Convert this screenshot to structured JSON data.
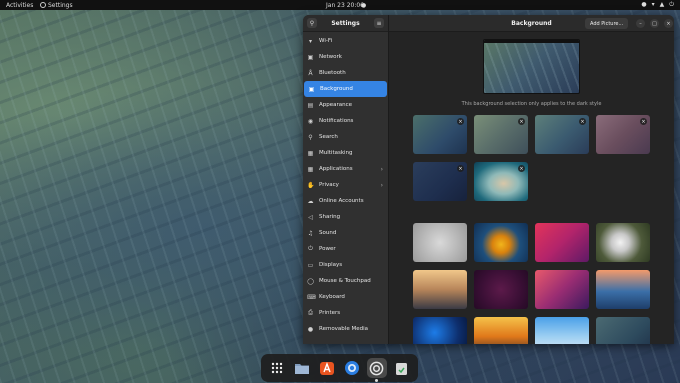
{
  "topbar": {
    "activities": "Activities",
    "app_name": "Settings",
    "clock": "Jan 23  20:06"
  },
  "window": {
    "sidebar_title": "Settings",
    "page_title": "Background",
    "add_picture": "Add Picture...",
    "caption": "This background selection only applies to the dark style"
  },
  "sidebar": {
    "items": [
      {
        "label": "Wi-Fi",
        "icon": "wifi-icon"
      },
      {
        "label": "Network",
        "icon": "network-icon"
      },
      {
        "label": "Bluetooth",
        "icon": "bluetooth-icon"
      },
      {
        "label": "Background",
        "icon": "background-icon"
      },
      {
        "label": "Appearance",
        "icon": "appearance-icon"
      },
      {
        "label": "Notifications",
        "icon": "bell-icon"
      },
      {
        "label": "Search",
        "icon": "search-icon"
      },
      {
        "label": "Multitasking",
        "icon": "multitasking-icon"
      },
      {
        "label": "Applications",
        "icon": "apps-icon"
      },
      {
        "label": "Privacy",
        "icon": "hand-icon"
      },
      {
        "label": "Online Accounts",
        "icon": "cloud-icon"
      },
      {
        "label": "Sharing",
        "icon": "share-icon"
      },
      {
        "label": "Sound",
        "icon": "music-note-icon"
      },
      {
        "label": "Power",
        "icon": "power-icon"
      },
      {
        "label": "Displays",
        "icon": "display-icon"
      },
      {
        "label": "Mouse & Touchpad",
        "icon": "mouse-icon"
      },
      {
        "label": "Keyboard",
        "icon": "keyboard-icon"
      },
      {
        "label": "Printers",
        "icon": "printer-icon"
      },
      {
        "label": "Removable Media",
        "icon": "media-icon"
      }
    ],
    "active": "Background"
  },
  "colors": {
    "accent": "#3584e4",
    "window_bg": "#242424",
    "sidebar_bg": "#303030"
  }
}
